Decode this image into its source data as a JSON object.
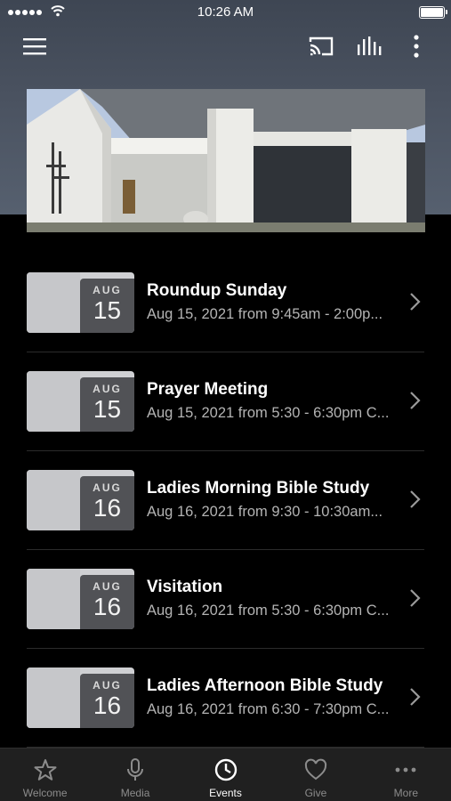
{
  "status_bar": {
    "time": "10:26 AM"
  },
  "events": [
    {
      "month": "AUG",
      "day": "15",
      "title": "Roundup Sunday",
      "time": "Aug 15, 2021 from 9:45am - 2:00p..."
    },
    {
      "month": "AUG",
      "day": "15",
      "title": "Prayer Meeting",
      "time": "Aug 15, 2021 from 5:30 - 6:30pm C..."
    },
    {
      "month": "AUG",
      "day": "16",
      "title": "Ladies Morning Bible Study",
      "time": "Aug 16, 2021 from 9:30 - 10:30am..."
    },
    {
      "month": "AUG",
      "day": "16",
      "title": "Visitation",
      "time": "Aug 16, 2021 from 5:30 - 6:30pm C..."
    },
    {
      "month": "AUG",
      "day": "16",
      "title": "Ladies Afternoon Bible Study",
      "time": "Aug 16, 2021 from 6:30 - 7:30pm C..."
    }
  ],
  "tabs": [
    {
      "label": "Welcome",
      "icon": "star-icon",
      "active": false
    },
    {
      "label": "Media",
      "icon": "microphone-icon",
      "active": false
    },
    {
      "label": "Events",
      "icon": "clock-icon",
      "active": true
    },
    {
      "label": "Give",
      "icon": "heart-icon",
      "active": false
    },
    {
      "label": "More",
      "icon": "ellipsis-icon",
      "active": false
    }
  ],
  "colors": {
    "header": "#4a5260",
    "background": "#000000",
    "tab_bar": "#202020",
    "active_tab": "#ffffff",
    "inactive_tab": "#8c8c8c"
  }
}
